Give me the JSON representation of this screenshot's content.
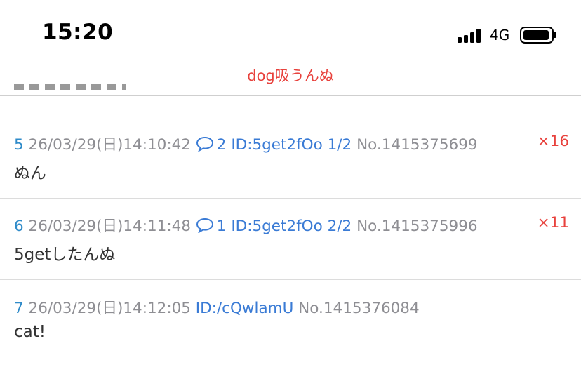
{
  "status_bar": {
    "time": "15:20",
    "network": "4G",
    "signal_icon": "signal-bars-icon",
    "battery_icon": "battery-icon"
  },
  "nav": {
    "title": "dog吸うんぬ"
  },
  "colors": {
    "accent_red": "#e8423d",
    "post_number_blue": "#2f8bc9",
    "link_blue": "#3a7bd5",
    "meta_gray": "#8e8e93"
  },
  "posts": [
    {
      "number": "5",
      "date": "26/03/29(日)14:10:42",
      "replies": "2",
      "id": "ID:5get2fOo",
      "id_count": "1/2",
      "no": "No.1415375699",
      "count": "×16",
      "body": "ぬん"
    },
    {
      "number": "6",
      "date": "26/03/29(日)14:11:48",
      "replies": "1",
      "id": "ID:5get2fOo",
      "id_count": "2/2",
      "no": "No.1415375996",
      "count": "×11",
      "body": "5getしたんぬ"
    },
    {
      "number": "7",
      "date": "26/03/29(日)14:12:05",
      "id": "ID:/cQwlamU",
      "no": "No.1415376084",
      "body": "cat!"
    }
  ]
}
